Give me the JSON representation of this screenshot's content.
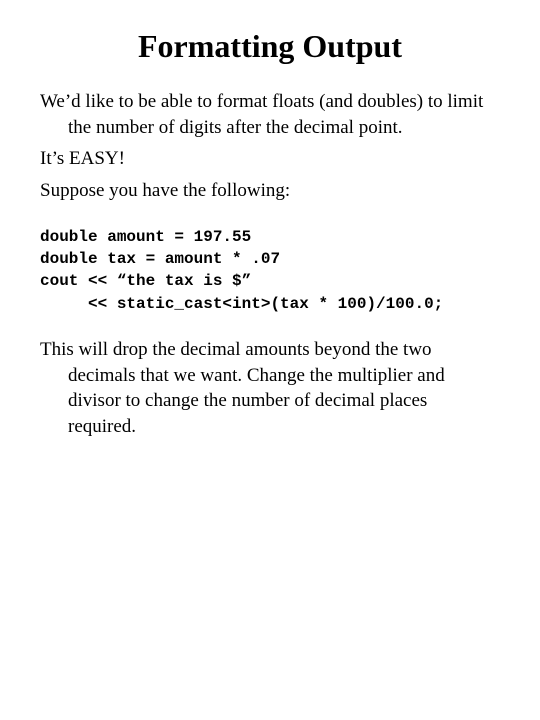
{
  "title": "Formatting Output",
  "para1": "We’d like to be able to format floats (and doubles) to limit the number of digits after the decimal point.",
  "para2": "It’s EASY!",
  "para3": "Suppose you have the following:",
  "code": "double amount = 197.55\ndouble tax = amount * .07\ncout << “the tax is $”\n     << static_cast<int>(tax * 100)/100.0;",
  "para4": "This will drop the decimal amounts beyond the two decimals that we want.  Change the multiplier and divisor to change the number of decimal places required."
}
